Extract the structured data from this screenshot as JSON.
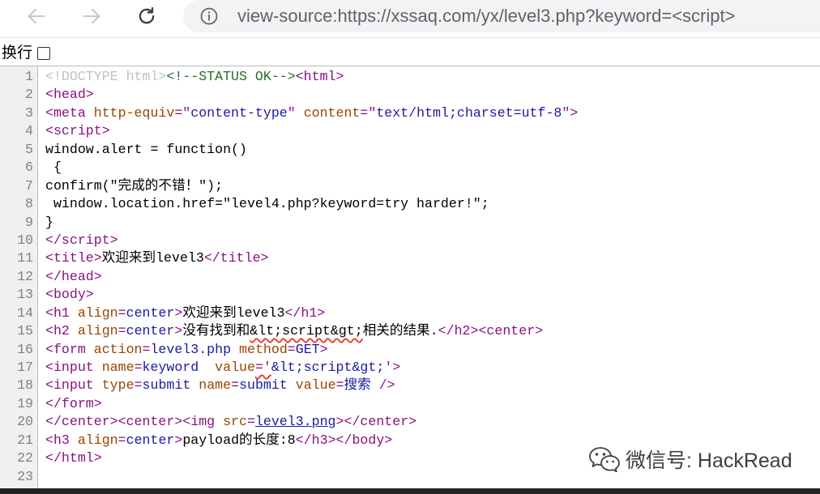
{
  "browser": {
    "url": {
      "scheme": "view-source:https://",
      "host": "xssaq.com",
      "path": "/yx/level3.php?keyword=<script>"
    },
    "icons": {
      "back": "back-arrow-icon",
      "forward": "forward-arrow-icon",
      "reload": "reload-icon",
      "site_info": "info-icon"
    },
    "back_enabled": false,
    "forward_enabled": false
  },
  "line_wrap": {
    "label": "换行",
    "checked": false
  },
  "source": {
    "line_number_color": "#808080",
    "lines": [
      {
        "n": "1",
        "tokens": [
          {
            "text": "<!DOCTYPE html>",
            "color": "#c0c0c0"
          },
          {
            "text": "<!--STATUS OK-->",
            "color": "#236e25"
          },
          {
            "text": "<html>",
            "color": "#881280"
          }
        ]
      },
      {
        "n": "2",
        "tokens": [
          {
            "text": "<head>",
            "color": "#881280"
          }
        ]
      },
      {
        "n": "3",
        "tokens": [
          {
            "text": "<meta ",
            "color": "#881280"
          },
          {
            "text": "http-equiv",
            "color": "#994500"
          },
          {
            "text": "=\"",
            "color": "#881280"
          },
          {
            "text": "content-type",
            "color": "#1a1aa6"
          },
          {
            "text": "\" ",
            "color": "#881280"
          },
          {
            "text": "content",
            "color": "#994500"
          },
          {
            "text": "=\"",
            "color": "#881280"
          },
          {
            "text": "text/html;charset=utf-8",
            "color": "#1a1aa6"
          },
          {
            "text": "\">",
            "color": "#881280"
          }
        ]
      },
      {
        "n": "4",
        "tokens": [
          {
            "text": "<script>",
            "color": "#881280"
          }
        ]
      },
      {
        "n": "5",
        "tokens": [
          {
            "text": "window.alert = function()",
            "color": "#000000"
          }
        ]
      },
      {
        "n": "6",
        "tokens": [
          {
            "text": " {",
            "color": "#000000"
          }
        ]
      },
      {
        "n": "7",
        "tokens": [
          {
            "text": "confirm(\"完成的不错！\");",
            "color": "#000000"
          }
        ]
      },
      {
        "n": "8",
        "tokens": [
          {
            "text": " window.location.href=\"level4.php?keyword=try harder!\";",
            "color": "#000000"
          }
        ]
      },
      {
        "n": "9",
        "tokens": [
          {
            "text": "}",
            "color": "#000000"
          }
        ]
      },
      {
        "n": "10",
        "tokens": [
          {
            "text": "</script>",
            "color": "#881280"
          }
        ]
      },
      {
        "n": "11",
        "tokens": [
          {
            "text": "<title>",
            "color": "#881280"
          },
          {
            "text": "欢迎来到level3",
            "color": "#000000"
          },
          {
            "text": "</title>",
            "color": "#881280"
          }
        ]
      },
      {
        "n": "12",
        "tokens": [
          {
            "text": "</head>",
            "color": "#881280"
          }
        ]
      },
      {
        "n": "13",
        "tokens": [
          {
            "text": "<body>",
            "color": "#881280"
          }
        ]
      },
      {
        "n": "14",
        "tokens": [
          {
            "text": "<h1 ",
            "color": "#881280"
          },
          {
            "text": "align",
            "color": "#994500"
          },
          {
            "text": "=",
            "color": "#881280"
          },
          {
            "text": "center",
            "color": "#1a1aa6"
          },
          {
            "text": ">",
            "color": "#881280"
          },
          {
            "text": "欢迎来到level3",
            "color": "#000000"
          },
          {
            "text": "</h1>",
            "color": "#881280"
          }
        ]
      },
      {
        "n": "15",
        "tokens": [
          {
            "text": "<h2 ",
            "color": "#881280"
          },
          {
            "text": "align",
            "color": "#994500"
          },
          {
            "text": "=",
            "color": "#881280"
          },
          {
            "text": "center",
            "color": "#1a1aa6"
          },
          {
            "text": ">",
            "color": "#881280"
          },
          {
            "text": "没有找到和",
            "color": "#000000"
          },
          {
            "text": "&lt;script&gt;",
            "color": "#000000",
            "underline_color": "#e8453c"
          },
          {
            "text": "相关的结果.",
            "color": "#000000"
          },
          {
            "text": "</h2>",
            "color": "#881280"
          },
          {
            "text": "<center>",
            "color": "#881280"
          }
        ]
      },
      {
        "n": "16",
        "tokens": [
          {
            "text": "<form ",
            "color": "#881280"
          },
          {
            "text": "action",
            "color": "#994500"
          },
          {
            "text": "=",
            "color": "#881280"
          },
          {
            "text": "level3.php",
            "color": "#1a1aa6"
          },
          {
            "text": " ",
            "color": "#881280"
          },
          {
            "text": "method",
            "color": "#994500"
          },
          {
            "text": "=",
            "color": "#881280"
          },
          {
            "text": "GET",
            "color": "#1a1aa6"
          },
          {
            "text": ">",
            "color": "#881280"
          }
        ]
      },
      {
        "n": "17",
        "tokens": [
          {
            "text": "<input ",
            "color": "#881280"
          },
          {
            "text": "name",
            "color": "#994500"
          },
          {
            "text": "=",
            "color": "#881280"
          },
          {
            "text": "keyword",
            "color": "#1a1aa6"
          },
          {
            "text": "  ",
            "color": "#881280"
          },
          {
            "text": "value",
            "color": "#994500"
          },
          {
            "text": "='",
            "color": "#881280",
            "underline_color": "#e8453c"
          },
          {
            "text": "&lt;script&gt;",
            "color": "#1a1aa6"
          },
          {
            "text": "'>",
            "color": "#881280"
          }
        ]
      },
      {
        "n": "18",
        "tokens": [
          {
            "text": "<input ",
            "color": "#881280"
          },
          {
            "text": "type",
            "color": "#994500"
          },
          {
            "text": "=",
            "color": "#881280"
          },
          {
            "text": "submit",
            "color": "#1a1aa6"
          },
          {
            "text": " ",
            "color": "#881280"
          },
          {
            "text": "name",
            "color": "#994500"
          },
          {
            "text": "=",
            "color": "#881280"
          },
          {
            "text": "submit",
            "color": "#1a1aa6"
          },
          {
            "text": " ",
            "color": "#881280"
          },
          {
            "text": "value",
            "color": "#994500"
          },
          {
            "text": "=",
            "color": "#881280"
          },
          {
            "text": "搜索",
            "color": "#1a1aa6"
          },
          {
            "text": " />",
            "color": "#881280"
          }
        ]
      },
      {
        "n": "19",
        "tokens": [
          {
            "text": "</form>",
            "color": "#881280"
          }
        ]
      },
      {
        "n": "20",
        "tokens": [
          {
            "text": "</center>",
            "color": "#881280"
          },
          {
            "text": "<center>",
            "color": "#881280"
          },
          {
            "text": "<img ",
            "color": "#881280"
          },
          {
            "text": "src",
            "color": "#994500"
          },
          {
            "text": "=",
            "color": "#881280"
          },
          {
            "text": "level3.png",
            "color": "#1a1aa6",
            "link": true
          },
          {
            "text": ">",
            "color": "#881280"
          },
          {
            "text": "</center>",
            "color": "#881280"
          }
        ]
      },
      {
        "n": "21",
        "tokens": [
          {
            "text": "<h3 ",
            "color": "#881280"
          },
          {
            "text": "align",
            "color": "#994500"
          },
          {
            "text": "=",
            "color": "#881280"
          },
          {
            "text": "center",
            "color": "#1a1aa6"
          },
          {
            "text": ">",
            "color": "#881280"
          },
          {
            "text": "payload的长度:8",
            "color": "#000000"
          },
          {
            "text": "</h3>",
            "color": "#881280"
          },
          {
            "text": "</body>",
            "color": "#881280"
          }
        ]
      },
      {
        "n": "22",
        "tokens": [
          {
            "text": "</html>",
            "color": "#881280"
          }
        ]
      },
      {
        "n": "23",
        "tokens": []
      }
    ]
  },
  "watermark": {
    "icon": "wechat-icon",
    "text": "微信号: HackRead"
  }
}
